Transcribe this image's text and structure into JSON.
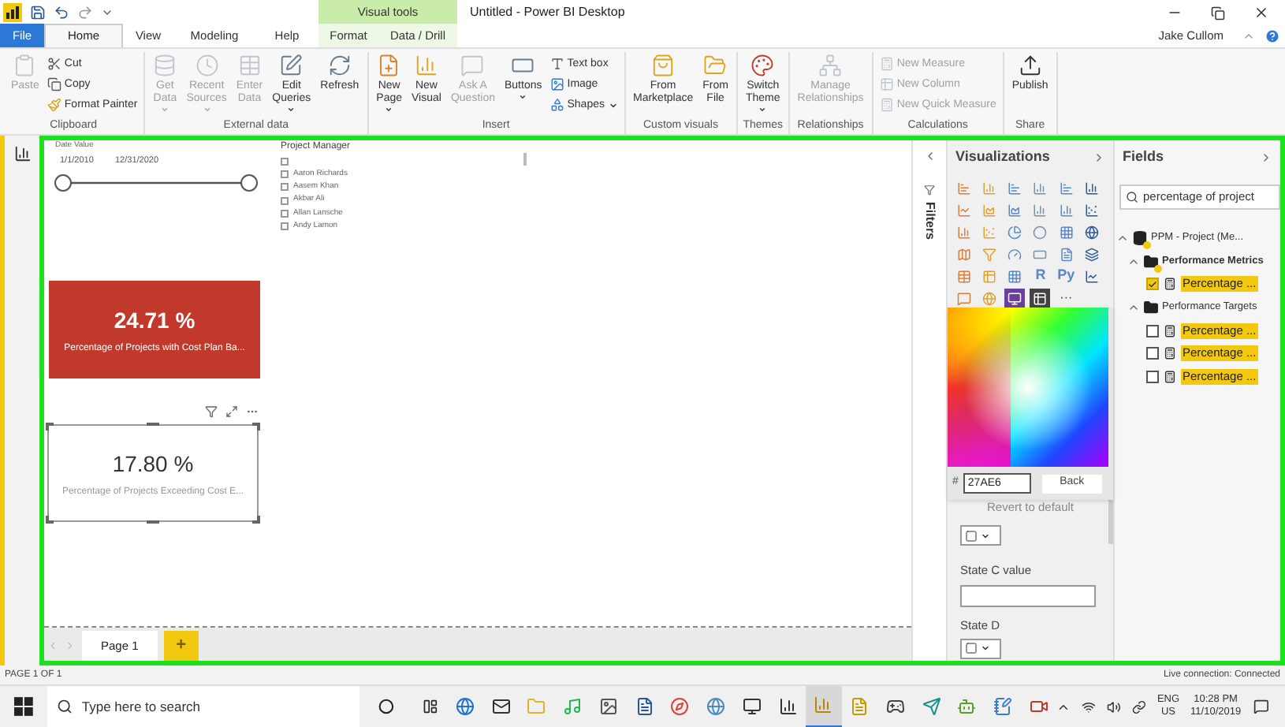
{
  "app": {
    "title": "Untitled - Power BI Desktop",
    "context_group": "Visual tools",
    "user": "Jake Cullom"
  },
  "tabs": [
    {
      "label": "File",
      "kind": "file",
      "selected": false
    },
    {
      "label": "Home",
      "kind": "main",
      "selected": true
    },
    {
      "label": "View",
      "kind": "main",
      "selected": false
    },
    {
      "label": "Modeling",
      "kind": "main",
      "selected": false
    },
    {
      "label": "Help",
      "kind": "main",
      "selected": false
    },
    {
      "label": "Format",
      "kind": "context",
      "selected": false
    },
    {
      "label": "Data / Drill",
      "kind": "context",
      "selected": false
    }
  ],
  "ribbon": [
    {
      "name": "Clipboard",
      "items": [
        {
          "label": "Paste",
          "kind": "large",
          "disabled": true,
          "dropdown": false
        },
        {
          "label": "Cut",
          "kind": "small",
          "disabled": false,
          "dropdown": false
        },
        {
          "label": "Copy",
          "kind": "small",
          "disabled": false,
          "dropdown": false
        },
        {
          "label": "Format Painter",
          "kind": "small",
          "disabled": false,
          "dropdown": false
        }
      ]
    },
    {
      "name": "External data",
      "items": [
        {
          "label": "Get\nData",
          "kind": "large",
          "disabled": true,
          "dropdown": true
        },
        {
          "label": "Recent\nSources",
          "kind": "large",
          "disabled": true,
          "dropdown": true
        },
        {
          "label": "Enter\nData",
          "kind": "large",
          "disabled": true,
          "dropdown": false
        },
        {
          "label": "Edit\nQueries",
          "kind": "large",
          "disabled": false,
          "dropdown": true
        },
        {
          "label": "Refresh",
          "kind": "large",
          "disabled": false,
          "dropdown": false
        }
      ]
    },
    {
      "name": "Insert",
      "items": [
        {
          "label": "New\nPage",
          "kind": "large",
          "disabled": false,
          "dropdown": true
        },
        {
          "label": "New\nVisual",
          "kind": "large",
          "disabled": false,
          "dropdown": false
        },
        {
          "label": "Ask A\nQuestion",
          "kind": "large",
          "disabled": true,
          "dropdown": false
        },
        {
          "label": "Buttons",
          "kind": "large",
          "disabled": false,
          "dropdown": true
        },
        {
          "label": "Text box",
          "kind": "small",
          "disabled": false,
          "dropdown": false
        },
        {
          "label": "Image",
          "kind": "small",
          "disabled": false,
          "dropdown": false
        },
        {
          "label": "Shapes",
          "kind": "small",
          "disabled": false,
          "dropdown": true
        }
      ]
    },
    {
      "name": "Custom visuals",
      "items": [
        {
          "label": "From\nMarketplace",
          "kind": "large",
          "disabled": false,
          "dropdown": false
        },
        {
          "label": "From\nFile",
          "kind": "large",
          "disabled": false,
          "dropdown": false
        }
      ]
    },
    {
      "name": "Themes",
      "items": [
        {
          "label": "Switch\nTheme",
          "kind": "large",
          "disabled": false,
          "dropdown": true
        }
      ]
    },
    {
      "name": "Relationships",
      "items": [
        {
          "label": "Manage\nRelationships",
          "kind": "large",
          "disabled": true,
          "dropdown": false
        }
      ]
    },
    {
      "name": "Calculations",
      "items": [
        {
          "label": "New Measure",
          "kind": "small",
          "disabled": true,
          "dropdown": false
        },
        {
          "label": "New Column",
          "kind": "small",
          "disabled": true,
          "dropdown": false
        },
        {
          "label": "New Quick Measure",
          "kind": "small",
          "disabled": true,
          "dropdown": false
        }
      ]
    },
    {
      "name": "Share",
      "items": [
        {
          "label": "Publish",
          "kind": "large",
          "disabled": false,
          "dropdown": false
        }
      ]
    }
  ],
  "canvas": {
    "date_slicer": {
      "title": "Date Value",
      "start": "1/1/2010",
      "end": "12/31/2020",
      "handles": [
        {
          "level": 0
        },
        {
          "level": 1
        }
      ]
    },
    "list_slicer": {
      "title": "Project Manager",
      "items": [
        {
          "checked": false
        },
        {
          "label": "Aaron Richards",
          "checked": false
        },
        {
          "label": "Aasem Khan",
          "checked": false
        },
        {
          "label": "Akbar Ali",
          "checked": false
        },
        {
          "label": "Allan Lansche",
          "checked": false
        },
        {
          "label": "Andy Lamon",
          "checked": false
        }
      ]
    },
    "cards": [
      {
        "value": "24.71 %",
        "label": "Percentage of Projects with Cost Plan Ba...",
        "color": "#c0392b",
        "selected": false
      },
      {
        "value": "17.80 %",
        "label": "Percentage of Projects Exceeding Cost E...",
        "selected": true
      }
    ],
    "pages": [
      {
        "label": "Page 1",
        "selected": true
      }
    ],
    "add_page": "+"
  },
  "filters": {
    "label": "Filters"
  },
  "visualizations": {
    "title": "Visualizations",
    "visuals": [
      {
        "selected": false
      },
      {
        "selected": false
      },
      {
        "selected": false
      },
      {
        "selected": false
      },
      {
        "selected": false
      },
      {
        "selected": false
      },
      {
        "selected": false
      },
      {
        "selected": false
      },
      {
        "selected": false
      },
      {
        "selected": false
      },
      {
        "selected": false
      },
      {
        "selected": false
      },
      {
        "selected": false
      },
      {
        "selected": false
      },
      {
        "selected": false
      },
      {
        "selected": false
      },
      {
        "selected": false
      },
      {
        "selected": false
      },
      {
        "selected": false
      },
      {
        "selected": false
      },
      {
        "selected": false
      },
      {
        "selected": false
      },
      {
        "selected": false
      },
      {
        "selected": false
      },
      {
        "selected": false
      },
      {
        "selected": false
      },
      {
        "selected": false
      },
      {
        "glyph": "R",
        "selected": false
      },
      {
        "glyph": "Py",
        "selected": false
      },
      {
        "selected": false
      },
      {
        "selected": false
      },
      {
        "selected": false
      },
      {
        "kind": "custom",
        "selected": false
      },
      {
        "selected": true
      }
    ],
    "more": "···",
    "color_picker": {
      "hex_label": "#",
      "hex_value": "27AE6",
      "back": "Back"
    },
    "revert": "Revert to default",
    "format": [
      {
        "kind": "color"
      },
      {
        "kind": "text",
        "label": "State C value"
      },
      {
        "kind": "color",
        "label": "State D"
      }
    ]
  },
  "fields": {
    "title": "Fields",
    "search": {
      "value": "percentage of project"
    },
    "tree": [
      {
        "label": "PPM - Project (Me...",
        "kind": "model",
        "expanded": true,
        "children": [
          {
            "label": "Performance Metrics",
            "kind": "table",
            "expanded": true,
            "in_use": true,
            "children": [
              {
                "label": "Percentage ...",
                "kind": "measure",
                "checked": true
              }
            ]
          },
          {
            "label": "Performance Targets",
            "kind": "table",
            "expanded": true,
            "in_use": false,
            "children": [
              {
                "label": "Percentage ...",
                "kind": "measure",
                "checked": false
              },
              {
                "label": "Percentage ...",
                "kind": "measure",
                "checked": false
              },
              {
                "label": "Percentage ...",
                "kind": "measure",
                "checked": false
              }
            ]
          }
        ]
      }
    ]
  },
  "status_bar": {
    "left": "PAGE 1 OF 1",
    "right": "Live connection: Connected"
  },
  "taskbar": {
    "search_placeholder": "Type here to search",
    "apps": [
      {
        "active": false
      },
      {
        "active": false
      },
      {
        "active": false
      },
      {
        "active": false
      },
      {
        "active": false
      },
      {
        "active": false
      },
      {
        "active": false
      },
      {
        "active": false
      },
      {
        "active": false
      },
      {
        "active": false
      },
      {
        "active": true
      },
      {
        "active": false
      },
      {
        "active": false
      },
      {
        "active": false
      },
      {
        "active": false
      },
      {
        "active": false
      },
      {
        "active": false
      }
    ],
    "language": "ENG",
    "region": "US",
    "time": "10:28 PM",
    "date": "11/10/2019"
  }
}
